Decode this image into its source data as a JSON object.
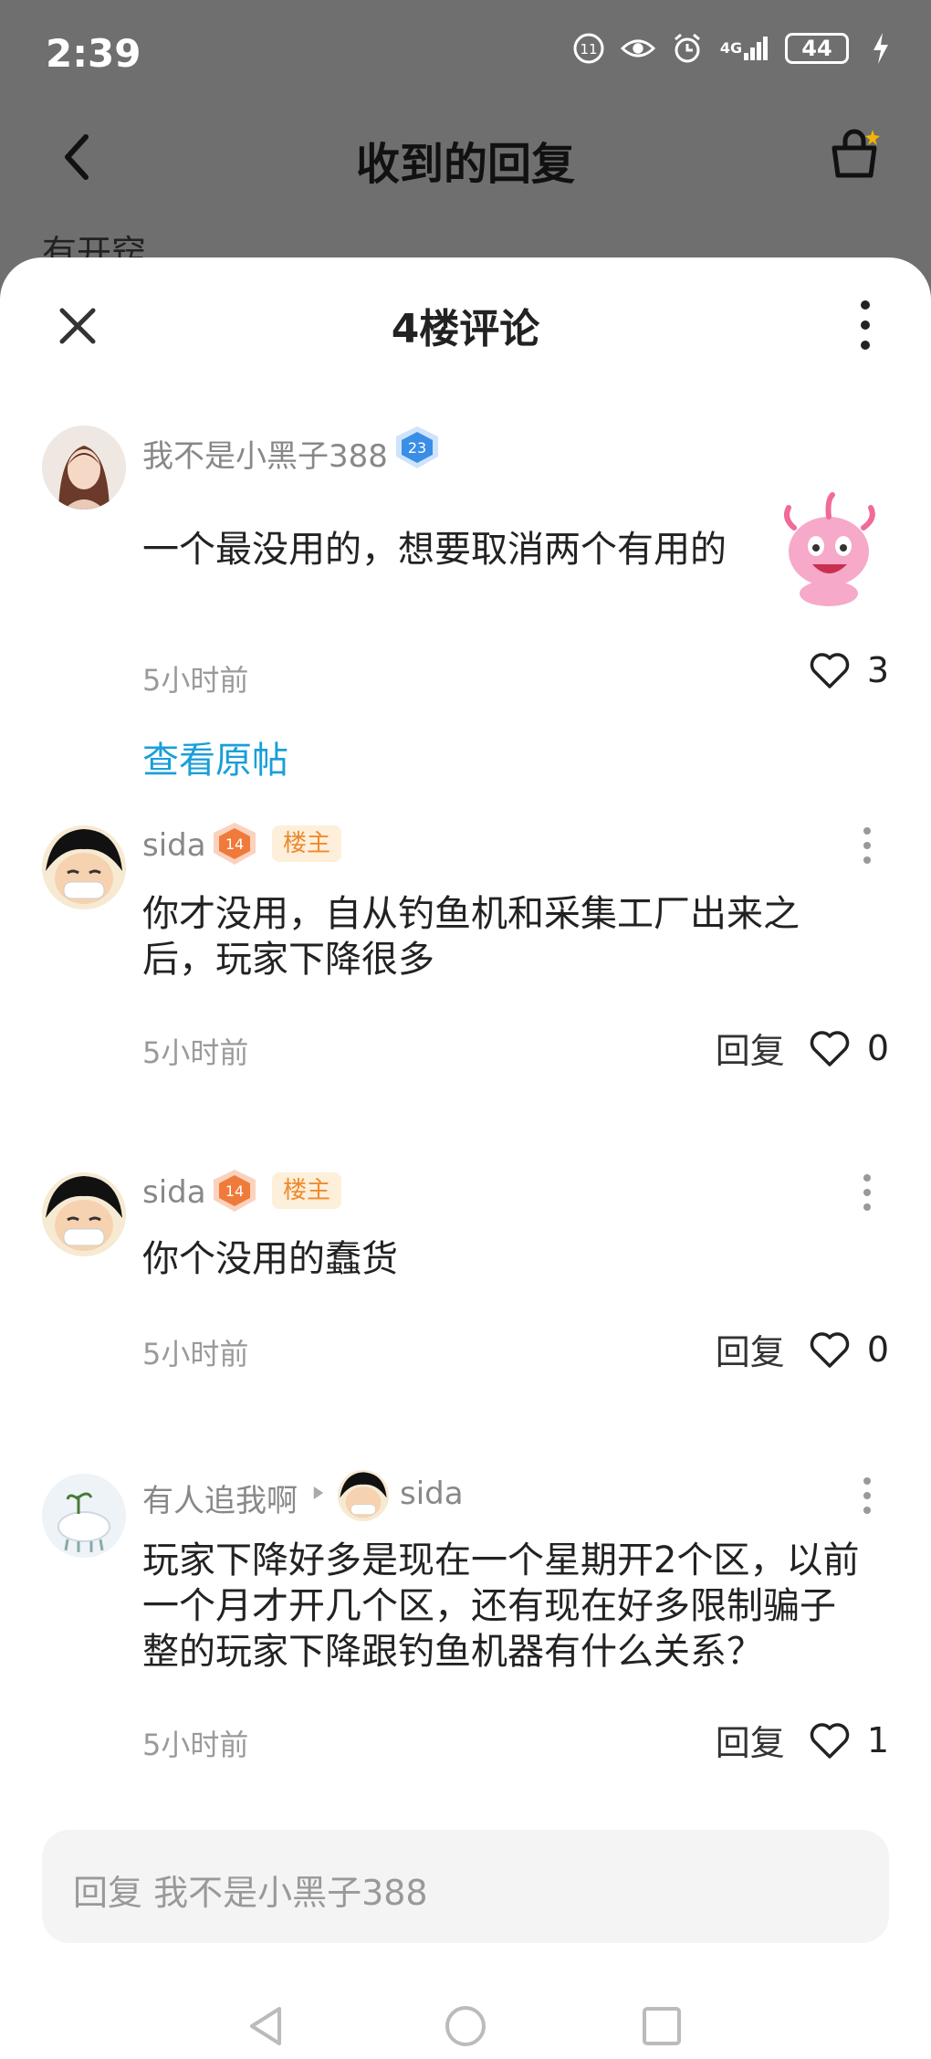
{
  "status_bar": {
    "time": "2:39",
    "network": "4G",
    "battery": "44"
  },
  "page": {
    "title": "收到的回复",
    "behind_text": "有开窍"
  },
  "sheet": {
    "title": "4楼评论"
  },
  "main_comment": {
    "username": "我不是小黑子388",
    "level": "23",
    "content": "一个最没用的，想要取消两个有用的",
    "time": "5小时前",
    "likes": "3",
    "view_original": "查看原帖"
  },
  "replies": [
    {
      "username": "sida",
      "level": "14",
      "tag": "楼主",
      "content": "你才没用，自从钓鱼机和采集工厂出来之后，玩家下降很多",
      "time": "5小时前",
      "reply_label": "回复",
      "likes": "0"
    },
    {
      "username": "sida",
      "level": "14",
      "tag": "楼主",
      "content": "你个没用的蠢货",
      "time": "5小时前",
      "reply_label": "回复",
      "likes": "0"
    },
    {
      "username": "有人追我啊",
      "reply_to": "sida",
      "content": "玩家下降好多是现在一个星期开2个区，以前一个月才开几个区，还有现在好多限制骗子整的玩家下降跟钓鱼机器有什么关系？",
      "time": "5小时前",
      "reply_label": "回复",
      "likes": "1"
    }
  ],
  "reply_input": {
    "placeholder": "回复 我不是小黑子388"
  },
  "colors": {
    "link": "#1a9fd8",
    "owner_tag_bg": "#fdefd9",
    "owner_tag_text": "#ef8a2e",
    "badge_blue": "#3a8ee6",
    "badge_orange": "#f07a3a"
  },
  "icons": [
    "back-arrow-icon",
    "basket-icon",
    "close-icon",
    "more-vertical-icon",
    "heart-icon",
    "level-badge-icon",
    "nav-back-icon",
    "nav-home-icon",
    "nav-recent-icon"
  ]
}
